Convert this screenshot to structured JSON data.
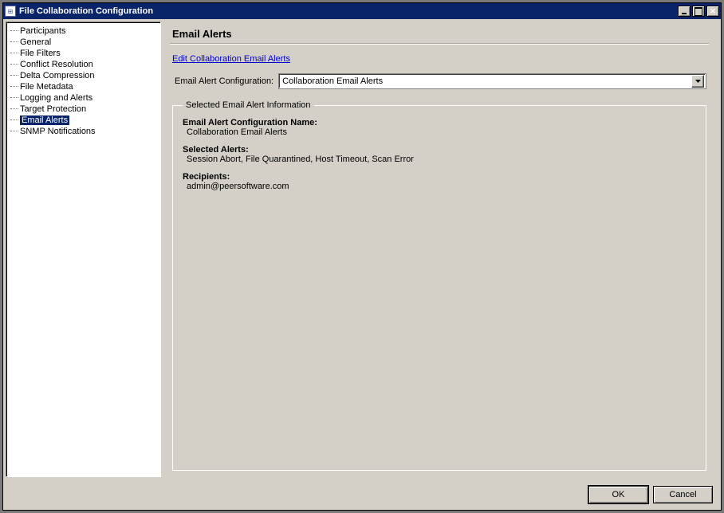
{
  "window": {
    "title": "File Collaboration Configuration"
  },
  "sidebar": {
    "items": [
      {
        "label": "Participants",
        "selected": false
      },
      {
        "label": "General",
        "selected": false
      },
      {
        "label": "File Filters",
        "selected": false
      },
      {
        "label": "Conflict Resolution",
        "selected": false
      },
      {
        "label": "Delta Compression",
        "selected": false
      },
      {
        "label": "File Metadata",
        "selected": false
      },
      {
        "label": "Logging and Alerts",
        "selected": false
      },
      {
        "label": "Target Protection",
        "selected": false
      },
      {
        "label": "Email Alerts",
        "selected": true
      },
      {
        "label": "SNMP Notifications",
        "selected": false
      }
    ]
  },
  "main": {
    "heading": "Email Alerts",
    "edit_link": "Edit Collaboration Email Alerts",
    "config_label": "Email Alert Configuration:",
    "config_value": "Collaboration Email Alerts",
    "fieldset_legend": "Selected Email Alert Information",
    "info": {
      "name_label": "Email Alert Configuration Name:",
      "name_value": "Collaboration Email Alerts",
      "alerts_label": "Selected Alerts:",
      "alerts_value": "Session Abort, File Quarantined, Host Timeout, Scan Error",
      "recipients_label": "Recipients:",
      "recipients_value": "admin@peersoftware.com"
    }
  },
  "buttons": {
    "ok": "OK",
    "cancel": "Cancel"
  }
}
